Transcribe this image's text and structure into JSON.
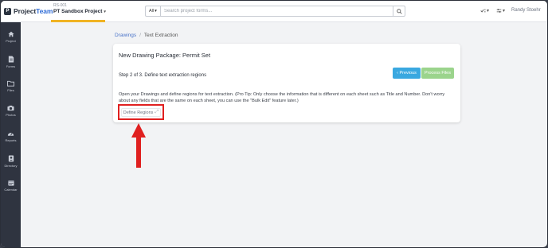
{
  "app": {
    "logo_mark": "P",
    "logo_text_main": "Project",
    "logo_text_accent": "Team"
  },
  "project": {
    "code": "RS-001",
    "name": "PT Sandbox Project",
    "caret": "▾"
  },
  "search": {
    "scope_label": "All",
    "scope_caret": "▾",
    "placeholder": "Search project forms..."
  },
  "toolbar": {
    "tool1_caret": "▾",
    "tool2_caret": "▾",
    "user_name": "Randy Stoehr"
  },
  "sidebar": {
    "items": [
      {
        "label": "Project",
        "icon": "home-icon"
      },
      {
        "label": "Forms",
        "icon": "document-icon"
      },
      {
        "label": "Files",
        "icon": "folder-icon"
      },
      {
        "label": "Photos",
        "icon": "camera-icon"
      },
      {
        "label": "Reports",
        "icon": "gauge-icon"
      },
      {
        "label": "Directory",
        "icon": "contact-card-icon"
      },
      {
        "label": "Calendar",
        "icon": "calendar-icon"
      }
    ]
  },
  "breadcrumb": {
    "link": "Drawings",
    "separator": "/",
    "current": "Text Extraction"
  },
  "card": {
    "title": "New Drawing Package: Permit Set",
    "step_text": "Step 2 of 3. Define text extraction regions",
    "prev_label": "‹ Previous",
    "process_label": "Process Files",
    "description": "Open your Drawings and define regions for text extraction. (Pro Tip: Only choose the information that is different on each sheet such as Title and Number. Don't worry about any fields that are the same on each sheet, you can use the \"Bulk Edit\" feature later.)",
    "define_label": "Define Regions",
    "define_icon": "⤢"
  },
  "colors": {
    "sidebar_bg": "#2f3440",
    "accent_yellow": "#f0b323",
    "prev_button": "#3aa8e0",
    "process_button": "#9bd48c",
    "highlight_red": "#e02020",
    "link_blue": "#4a74c9"
  }
}
